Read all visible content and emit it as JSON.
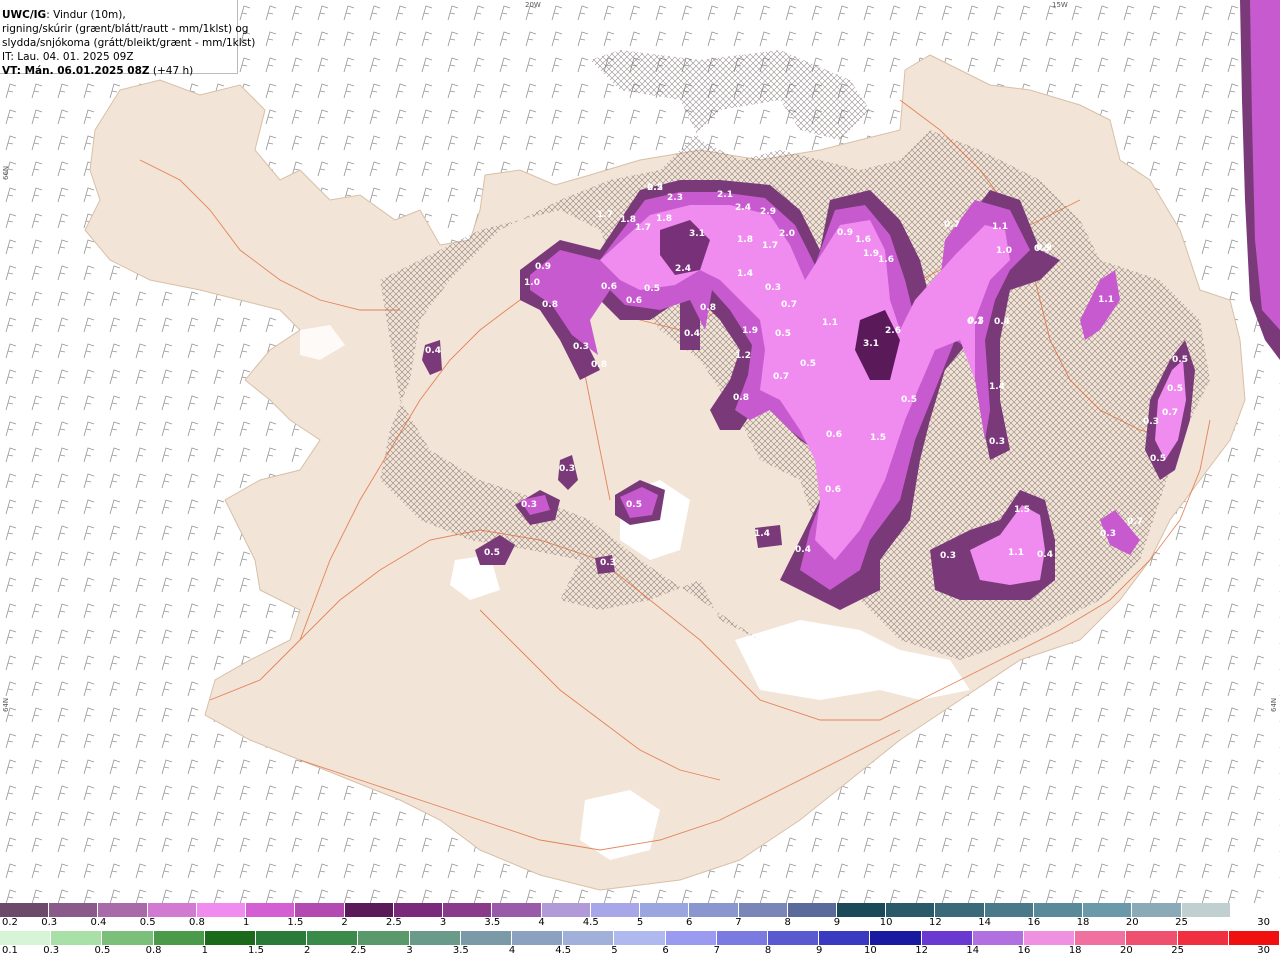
{
  "header": {
    "line1_bold": "UWC/IG",
    "line1_rest": ": Vindur (10m),",
    "line2": "rigning/skúrir (grænt/blátt/rautt - mm/1klst) og",
    "line3": "slydda/snjókoma (grátt/bleikt/grænt - mm/1klst)",
    "line4": "IT: Lau. 04. 01. 2025 09Z",
    "line5_bold": "VT: Mán. 06.01.2025 08Z",
    "line5_rest": " (+47 h)"
  },
  "axis_labels": {
    "top_left": "20W",
    "top_right": "15W",
    "left_top": "66N",
    "left_bottom": "64N",
    "right_bottom": "64N"
  },
  "colors": {
    "land": "#f2e4d6",
    "sea": "#ffffff",
    "roads": "#e06b3a",
    "snow_light": "#f08cf0",
    "snow_mid": "#c85ad0",
    "snow_dark": "#7a3a7a"
  },
  "precip_labels": [
    "2.2",
    "2.3",
    "2.1",
    "2.4",
    "2.9",
    "1.7",
    "1.8",
    "1.7",
    "1.8",
    "3.1",
    "2.4",
    "1.8",
    "2.0",
    "1.7",
    "0.9",
    "1.6",
    "1.9",
    "1.6",
    "0.7",
    "1.1",
    "1.0",
    "0.5",
    "0.9",
    "1.0",
    "0.8",
    "0.6",
    "0.6",
    "0.5",
    "0.8",
    "0.4",
    "1.4",
    "0.3",
    "0.7",
    "0.5",
    "1.1",
    "2.6",
    "3.1",
    "0.1",
    "0.4",
    "1.9",
    "1.2",
    "0.7",
    "0.5",
    "0.8",
    "0.5",
    "1.5",
    "0.6",
    "0.5",
    "0.5",
    "0.7",
    "0.5",
    "0.3",
    "0.3",
    "0.3",
    "0.3",
    "0.5",
    "1.5",
    "0.5",
    "0.3",
    "1.4",
    "0.4",
    "0.6",
    "0.3",
    "0.4",
    "0.3",
    "0.7",
    "1.1",
    "1.1",
    "0.3",
    "1.4",
    "0.4",
    "0.3",
    "0.8",
    "0.9",
    "0.5"
  ],
  "legend": {
    "snow": {
      "labels": [
        "0.2",
        "0.3",
        "0.4",
        "0.5",
        "0.8",
        "1",
        "1.5",
        "2",
        "2.5",
        "3",
        "3.5",
        "4",
        "4.5",
        "5",
        "6",
        "7",
        "8",
        "9",
        "10",
        "12",
        "14",
        "16",
        "18",
        "20",
        "25",
        "30"
      ],
      "colors": [
        "#6b4a6b",
        "#8a5a8a",
        "#a86aa8",
        "#d27ad2",
        "#f08cf0",
        "#d35fd3",
        "#b24ab2",
        "#5a1a5a",
        "#7a2a7a",
        "#8a3a8a",
        "#9a5aaa",
        "#b09ad8",
        "#a6a6e8",
        "#9aa6e0",
        "#8a96d0",
        "#7a86b8",
        "#5a6a9a",
        "#1a4a5a",
        "#2a5a6a",
        "#3a6a7a",
        "#4a7a8a",
        "#5a8a9a",
        "#6a9aaa",
        "#8aaab8",
        "#c0d0d0",
        "#ffffff"
      ]
    },
    "rain": {
      "labels": [
        "0.1",
        "0.3",
        "0.5",
        "0.8",
        "1",
        "1.5",
        "2",
        "2.5",
        "3",
        "3.5",
        "4",
        "4.5",
        "5",
        "6",
        "7",
        "8",
        "9",
        "10",
        "12",
        "14",
        "16",
        "18",
        "20",
        "25",
        "30"
      ],
      "colors": [
        "#d6f5d6",
        "#a8e0a8",
        "#7ac07a",
        "#4a9a4a",
        "#1a6a1a",
        "#2a7a3a",
        "#3a8a4a",
        "#5a9a6a",
        "#6a9a8a",
        "#7a9aa8",
        "#8aa2c0",
        "#a0b0d8",
        "#b0b8f0",
        "#9a9af0",
        "#7a7ae0",
        "#5a5ad0",
        "#3a3ac0",
        "#1a1aa0",
        "#6a3ad0",
        "#b070e0",
        "#f090e0",
        "#f070a0",
        "#f05070",
        "#f03040",
        "#f01010"
      ]
    }
  }
}
